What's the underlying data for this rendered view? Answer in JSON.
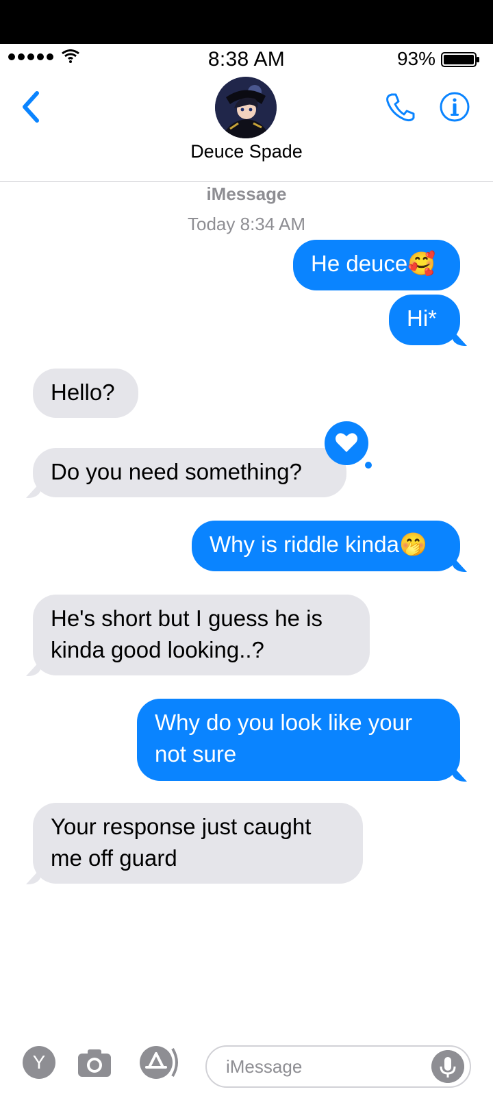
{
  "status": {
    "time": "8:38 AM",
    "battery_percent": "93%"
  },
  "contact": {
    "name": "Deuce Spade"
  },
  "thread": {
    "service": "iMessage",
    "timestamp": "Today 8:34 AM"
  },
  "messages": [
    {
      "dir": "out",
      "text": "He deuce🥰"
    },
    {
      "dir": "out",
      "text": "Hi*"
    },
    {
      "dir": "in",
      "text": "Hello?"
    },
    {
      "dir": "in",
      "text": "Do you need something?"
    },
    {
      "dir": "out",
      "text": "Why is riddle kinda🤭"
    },
    {
      "dir": "in",
      "text": "He's short but I guess he is kinda good looking..?"
    },
    {
      "dir": "out",
      "text": "Why do you look like your not sure"
    },
    {
      "dir": "in",
      "text": "Your response just caught me off guard"
    }
  ],
  "reaction": {
    "icon": "heart-icon"
  },
  "composer": {
    "placeholder": "iMessage",
    "apps_icon_letter": "Y"
  },
  "colors": {
    "accent": "#0a84ff",
    "incoming_bubble": "#e5e5ea",
    "secondary_text": "#8e8e93"
  }
}
